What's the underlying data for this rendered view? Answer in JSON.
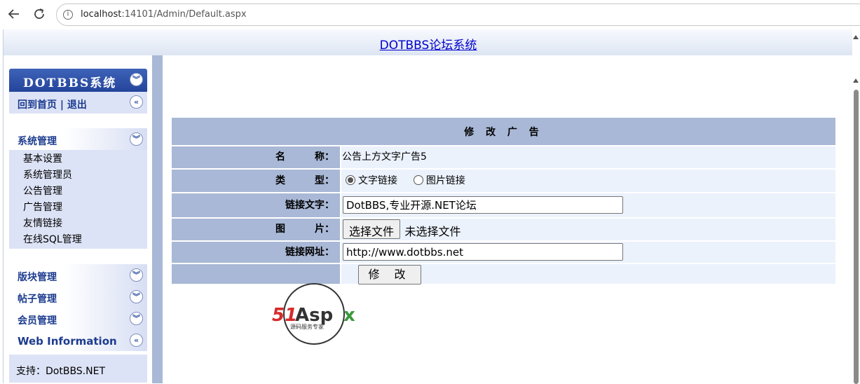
{
  "browser": {
    "url_host": "localhost",
    "url_path": ":14101/Admin/Default.aspx"
  },
  "banner": {
    "title": "DOTBBS论坛系统"
  },
  "sidebar": {
    "brand": "DOTBBS系统",
    "home_logout": "回到首页 | 退出",
    "sections": {
      "system": {
        "label": "系统管理",
        "items": [
          "基本设置",
          "系统管理员",
          "公告管理",
          "广告管理",
          "友情链接",
          "在线SQL管理"
        ]
      },
      "board": {
        "label": "版块管理"
      },
      "post": {
        "label": "帖子管理"
      },
      "member": {
        "label": "会员管理"
      },
      "web_info": {
        "label": "Web Information"
      }
    },
    "support": "支持：DotBBS.NET"
  },
  "form": {
    "title": "修 改 广 告",
    "name_label": "名　　　称：",
    "name_value": "公告上方文字广告5",
    "type_label": "类　　　型：",
    "type_options": [
      "文字链接",
      "图片链接"
    ],
    "type_selected": "文字链接",
    "link_text_label": "链接文字：",
    "link_text_value": "DotBBS,专业开源.NET论坛",
    "image_label": "图　　　片：",
    "file_button": "选择文件",
    "file_status": "未选择文件",
    "link_url_label": "链接网址：",
    "link_url_value": "http://www.dotbbs.net",
    "submit_label": "修 改"
  },
  "logo": {
    "text_main": "51Aspx",
    "text_sub": "源码服务专家"
  },
  "colors": {
    "sidebar_stripe": "#a9b8d6",
    "panel_bg": "#dde3f6",
    "brand_blue": "#2b4ca3",
    "link_blue": "#0000cc"
  }
}
